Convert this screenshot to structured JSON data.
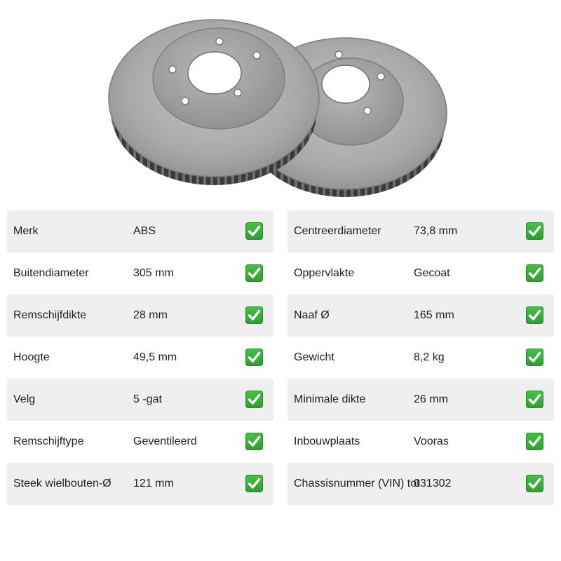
{
  "product_image": {
    "icon": "brake-discs-pair-photo",
    "colors": {
      "disc": "#a9a9a7",
      "hub": "#9d9d9b",
      "vents": "#3a3a38"
    }
  },
  "specs": {
    "check_icon": "check-mark-icon",
    "check_color": "#3cb43e",
    "row_shade": "#efefef",
    "left": [
      {
        "label": "Merk",
        "value": "ABS",
        "checked": true
      },
      {
        "label": "Buitendiameter",
        "value": "305 mm",
        "checked": true
      },
      {
        "label": "Remschijfdikte",
        "value": "28 mm",
        "checked": true
      },
      {
        "label": "Hoogte",
        "value": "49,5 mm",
        "checked": true
      },
      {
        "label": "Velg",
        "value": "5 -gat",
        "checked": true
      },
      {
        "label": "Remschijftype",
        "value": "Geventileerd",
        "checked": true
      },
      {
        "label": "Steek wielbouten-Ø",
        "value": "121 mm",
        "checked": true
      }
    ],
    "right": [
      {
        "label": "Centreerdiameter",
        "value": "73,8 mm",
        "checked": true
      },
      {
        "label": "Oppervlakte",
        "value": "Gecoat",
        "checked": true
      },
      {
        "label": "Naaf Ø",
        "value": "165 mm",
        "checked": true
      },
      {
        "label": "Gewicht",
        "value": "8,2 kg",
        "checked": true
      },
      {
        "label": "Minimale dikte",
        "value": "26 mm",
        "checked": true
      },
      {
        "label": "Inbouwplaats",
        "value": "Vooras",
        "checked": true
      },
      {
        "label": "Chassisnummer (VIN) tot",
        "value": "031302",
        "checked": true
      }
    ]
  }
}
